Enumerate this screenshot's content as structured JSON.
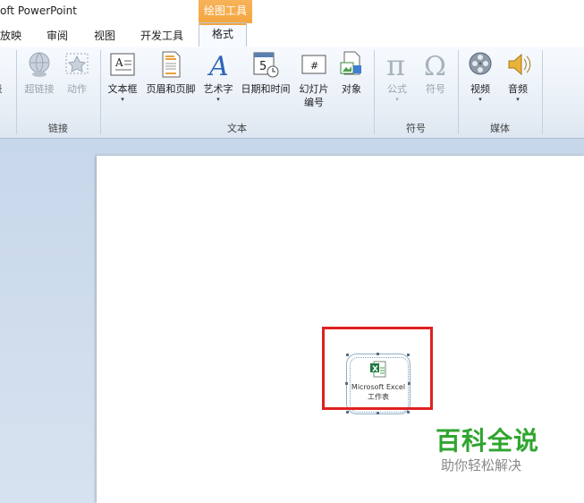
{
  "titlebar": {
    "app_title": "oft PowerPoint",
    "context_header": "绘图工具"
  },
  "tabs": [
    {
      "label": "放映"
    },
    {
      "label": "审阅"
    },
    {
      "label": "视图"
    },
    {
      "label": "开发工具"
    },
    {
      "label": "格式"
    }
  ],
  "ribbon": {
    "left_cut_label": "表",
    "groups": {
      "links": "链接",
      "text": "文本",
      "symbols": "符号",
      "media": "媒体"
    },
    "commands": {
      "hyperlink": "超链接",
      "action": "动作",
      "textbox": "文本框",
      "header_footer": "页眉和页脚",
      "wordart": "艺术字",
      "datetime": "日期和时间",
      "slide_number_1": "幻灯片",
      "slide_number_2": "编号",
      "object": "对象",
      "equation": "公式",
      "symbol": "符号",
      "video": "视频",
      "audio": "音频"
    },
    "arrow": "▾"
  },
  "slide": {
    "object_label_1": "Microsoft Excel",
    "object_label_2": "工作表"
  },
  "watermark": {
    "brand": "百科全说",
    "sub": "助你轻松解决"
  },
  "colors": {
    "accent_orange": "#f4a640",
    "highlight_red": "#e02020",
    "brand_green": "#2fa52f"
  }
}
